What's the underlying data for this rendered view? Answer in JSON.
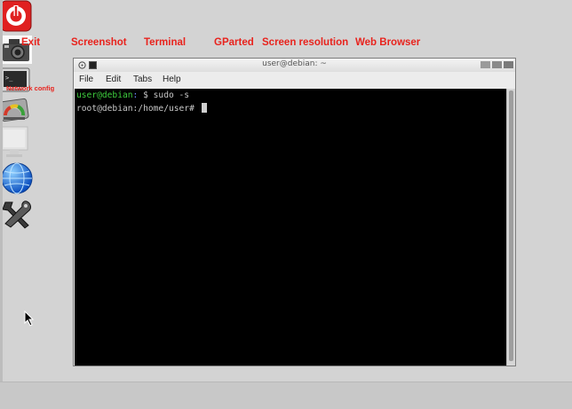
{
  "desktop": {
    "icons": [
      {
        "id": "exit",
        "label": "Exit"
      },
      {
        "id": "screenshot",
        "label": "Screenshot"
      },
      {
        "id": "terminal",
        "label": "Terminal"
      },
      {
        "id": "gparted",
        "label": "GParted"
      },
      {
        "id": "screen_resolution",
        "label": "Screen resolution"
      },
      {
        "id": "web_browser",
        "label": "Web Browser"
      },
      {
        "id": "network_config",
        "label": "Network config"
      }
    ]
  },
  "terminal": {
    "title": "user@debian: ~",
    "menu": [
      "File",
      "Edit",
      "Tabs",
      "Help"
    ],
    "lines": [
      {
        "user_host": "user@debian",
        "path": ":",
        "rest": " $ sudo -s"
      },
      {
        "text": "root@debian:/home/user# "
      }
    ]
  },
  "colors": {
    "label_red": "#e8231d",
    "desktop_bg": "#d3d3d3",
    "terminal_bg": "#000000",
    "prompt_green": "#3fcf3f"
  }
}
